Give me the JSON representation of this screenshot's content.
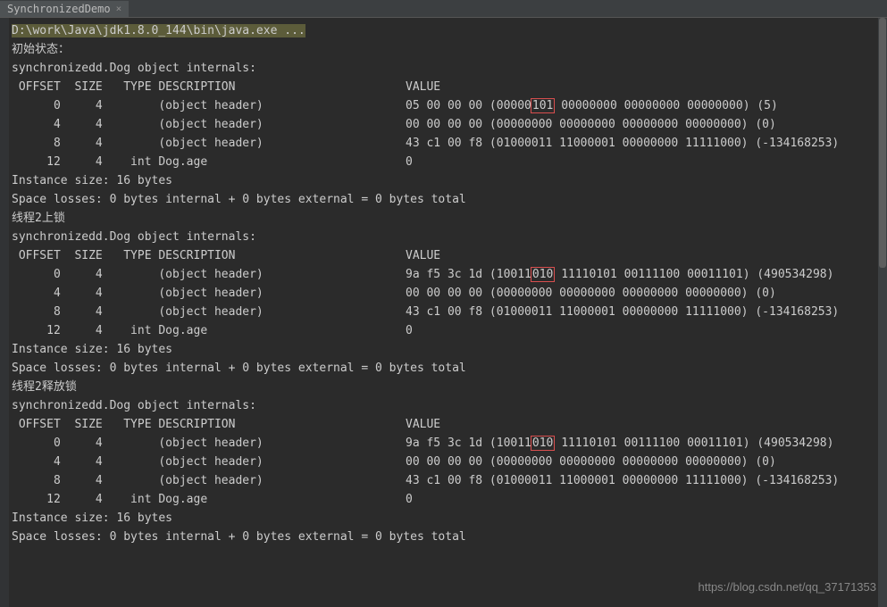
{
  "tab": {
    "title": "SynchronizedDemo"
  },
  "cmdline": "D:\\work\\Java\\jdk1.8.0_144\\bin\\java.exe ...",
  "sections": [
    {
      "title": "初始状态：",
      "internals": "synchronizedd.Dog object internals:",
      "header": {
        "offset": " OFFSET  SIZE   TYPE DESCRIPTION",
        "value": "VALUE"
      },
      "rows": [
        {
          "left": "      0     4        (object header)",
          "val_pre": "05 00 00 00 (00000",
          "val_hl": "101",
          "val_post": " 00000000 00000000 00000000) (5)"
        },
        {
          "left": "      4     4        (object header)",
          "val_pre": "00 00 00 00 (00000000 00000000 00000000 00000000) (0)",
          "val_hl": "",
          "val_post": ""
        },
        {
          "left": "      8     4        (object header)",
          "val_pre": "43 c1 00 f8 (01000011 11000001 00000000 11111000) (-134168253)",
          "val_hl": "",
          "val_post": ""
        },
        {
          "left": "     12     4    int Dog.age",
          "val_pre": "0",
          "val_hl": "",
          "val_post": ""
        }
      ],
      "instanceSize": "Instance size: 16 bytes",
      "spaceLosses": "Space losses: 0 bytes internal + 0 bytes external = 0 bytes total"
    },
    {
      "title": "线程2上锁",
      "internals": "synchronizedd.Dog object internals:",
      "header": {
        "offset": " OFFSET  SIZE   TYPE DESCRIPTION",
        "value": "VALUE"
      },
      "rows": [
        {
          "left": "      0     4        (object header)",
          "val_pre": "9a f5 3c 1d (10011",
          "val_hl": "010",
          "val_post": " 11110101 00111100 00011101) (490534298)"
        },
        {
          "left": "      4     4        (object header)",
          "val_pre": "00 00 00 00 (00000000 00000000 00000000 00000000) (0)",
          "val_hl": "",
          "val_post": ""
        },
        {
          "left": "      8     4        (object header)",
          "val_pre": "43 c1 00 f8 (01000011 11000001 00000000 11111000) (-134168253)",
          "val_hl": "",
          "val_post": ""
        },
        {
          "left": "     12     4    int Dog.age",
          "val_pre": "0",
          "val_hl": "",
          "val_post": ""
        }
      ],
      "instanceSize": "Instance size: 16 bytes",
      "spaceLosses": "Space losses: 0 bytes internal + 0 bytes external = 0 bytes total"
    },
    {
      "title": "线程2释放锁",
      "internals": "synchronizedd.Dog object internals:",
      "header": {
        "offset": " OFFSET  SIZE   TYPE DESCRIPTION",
        "value": "VALUE"
      },
      "rows": [
        {
          "left": "      0     4        (object header)",
          "val_pre": "9a f5 3c 1d (10011",
          "val_hl": "010",
          "val_post": " 11110101 00111100 00011101) (490534298)"
        },
        {
          "left": "      4     4        (object header)",
          "val_pre": "00 00 00 00 (00000000 00000000 00000000 00000000) (0)",
          "val_hl": "",
          "val_post": ""
        },
        {
          "left": "      8     4        (object header)",
          "val_pre": "43 c1 00 f8 (01000011 11000001 00000000 11111000) (-134168253)",
          "val_hl": "",
          "val_post": ""
        },
        {
          "left": "     12     4    int Dog.age",
          "val_pre": "0",
          "val_hl": "",
          "val_post": ""
        }
      ],
      "instanceSize": "Instance size: 16 bytes",
      "spaceLosses": "Space losses: 0 bytes internal + 0 bytes external = 0 bytes total"
    }
  ],
  "watermark": "https://blog.csdn.net/qq_37171353",
  "layout": {
    "leftColWidth": 441
  }
}
